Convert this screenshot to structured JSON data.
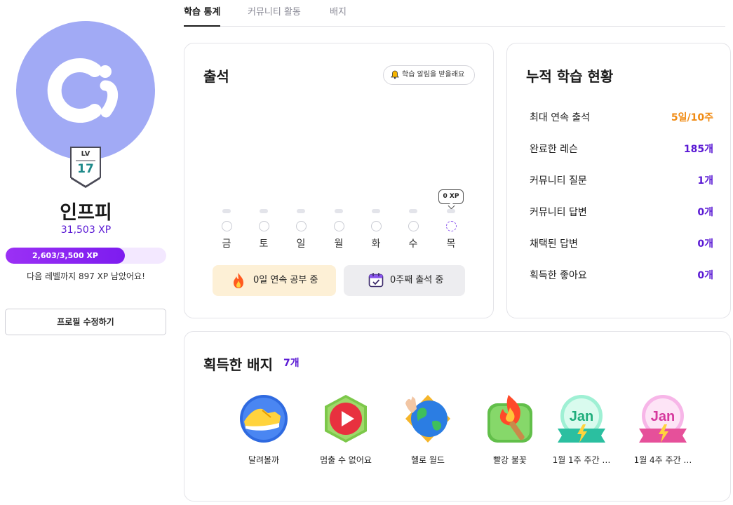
{
  "profile": {
    "lv_label": "LV",
    "level": "17",
    "nickname": "인프피",
    "total_xp": "31,503 XP",
    "xp_progress_label": "2,603/3,500 XP",
    "xp_progress_fraction": 0.744,
    "next_level_text": "다음 레벨까지 897 XP 남았어요!",
    "edit_button": "프로필 수정하기"
  },
  "tabs": [
    {
      "label": "학습 통계",
      "active": true
    },
    {
      "label": "커뮤니티 활동",
      "active": false
    },
    {
      "label": "배지",
      "active": false
    }
  ],
  "attendance": {
    "title": "출석",
    "notify_button": "학습 알림을 받을래요",
    "xp_tooltip": "0 XP",
    "days": [
      "금",
      "토",
      "일",
      "월",
      "화",
      "수",
      "목"
    ],
    "streak_study": "0일 연속 공부 중",
    "streak_week": "0주째 출석 중"
  },
  "cumulative": {
    "title": "누적 학습 현황",
    "stats": [
      {
        "label": "최대 연속 출석",
        "value": "5일/10주"
      },
      {
        "label": "완료한 레슨",
        "value": "185개"
      },
      {
        "label": "커뮤니티 질문",
        "value": "1개"
      },
      {
        "label": "커뮤니티 답변",
        "value": "0개"
      },
      {
        "label": "채택된 답변",
        "value": "0개"
      },
      {
        "label": "획득한 좋아요",
        "value": "0개"
      }
    ]
  },
  "badges": {
    "title": "획득한 배지",
    "count": "7개",
    "items": [
      {
        "name": "달려볼까",
        "icon": "sneaker-badge-icon"
      },
      {
        "name": "멈출 수 없어요",
        "icon": "play-badge-icon"
      },
      {
        "name": "헬로 월드",
        "icon": "globe-badge-icon"
      },
      {
        "name": "빨강 불꽃",
        "icon": "torch-badge-icon"
      },
      {
        "name": "1월 1주 주간 …",
        "icon": "jan-green-badge-icon",
        "emblem": "Jan"
      },
      {
        "name": "1월 4주 주간 …",
        "icon": "jan-pink-badge-icon",
        "emblem": "Jan"
      }
    ]
  },
  "colors": {
    "accent_purple": "#5a19d4",
    "progress_purple": "#8a25f2",
    "highlight_orange": "#f08a12",
    "avatar_bg": "#a1aaf5"
  }
}
